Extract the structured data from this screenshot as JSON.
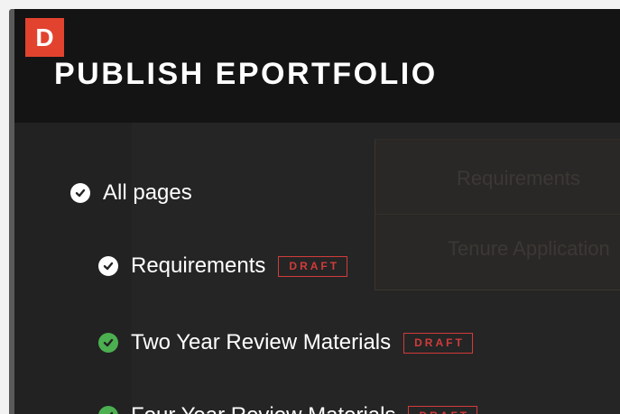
{
  "header": {
    "brand_letter": "D",
    "title": "PUBLISH EPORTFOLIO"
  },
  "tree": {
    "all_pages": {
      "label": "All pages",
      "icon": "check-circle-icon",
      "icon_color": "#ffffff"
    },
    "items": [
      {
        "label": "Requirements",
        "status": "DRAFT",
        "icon": "check-circle-icon",
        "icon_color": "#ffffff"
      },
      {
        "label": "Two Year Review Materials",
        "status": "DRAFT",
        "icon": "check-circle-icon",
        "icon_color": "#4caf50"
      },
      {
        "label": "Four Year Review Materials",
        "status": "DRAFT",
        "icon": "check-circle-icon",
        "icon_color": "#4caf50"
      }
    ]
  },
  "background_panel": {
    "items": [
      "Requirements",
      "Tenure Application"
    ]
  },
  "colors": {
    "brand": "#e1432f",
    "draft": "#d23b3b",
    "check_green": "#4caf50",
    "header_bg": "#141414",
    "content_bg": "#222222"
  }
}
